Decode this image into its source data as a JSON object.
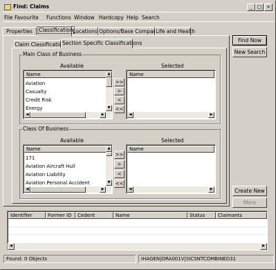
{
  "window": {
    "title": "Find: Claims"
  },
  "menu": [
    "File",
    "Favourite",
    "Functions",
    "Window",
    "Hardcopy",
    "Help",
    "Search"
  ],
  "tabs": [
    "Properties",
    "Classification",
    "Locations",
    "Options/Base Companies",
    "Life and Health"
  ],
  "subtabs": [
    "Claim Classifications",
    "Section Specific Classifications"
  ],
  "main_class": {
    "group_label": "Main Class of Business",
    "available_title": "Available",
    "selected_title": "Selected",
    "name_header": "Name",
    "selected_name_header": "Name",
    "items": [
      "Aviation",
      "Casualty",
      "Credit Risk",
      "Energy"
    ],
    "move_buttons": [
      ">>",
      ">",
      "<",
      "<<"
    ]
  },
  "class_of_business": {
    "group_label": "Class Of Business",
    "available_title": "Available",
    "selected_title": "Selected",
    "name_header": "Name",
    "selected_name_header": "Name",
    "items": [
      "171",
      "Aviation Aircraft Hull",
      "Aviation Liability",
      "Aviation Personal Accident"
    ],
    "move_buttons": [
      ">>",
      ">",
      "<",
      "<<"
    ]
  },
  "buttons": {
    "find_now": "Find Now",
    "new_search": "New Search",
    "create_new": "Create New",
    "more": "More"
  },
  "results": {
    "columns": [
      "Identifier",
      "Former ID",
      "Cedent",
      "Name",
      "Status",
      "Claimants"
    ]
  },
  "status": {
    "found": "Found: 0 Objects",
    "connection": "IHAGEN|ORA001V|SICSNTCOMBINED31"
  }
}
